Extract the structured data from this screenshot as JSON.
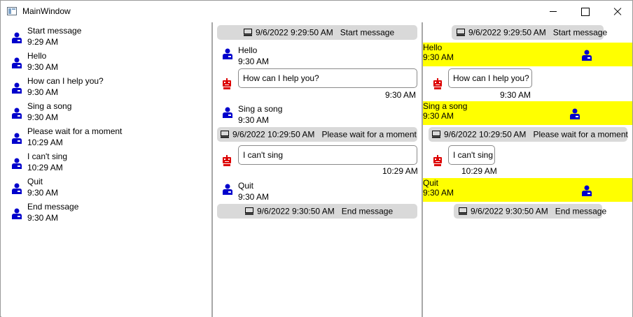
{
  "window": {
    "title": "MainWindow"
  },
  "list_view": [
    {
      "text": "Start message",
      "time": "9:29 AM"
    },
    {
      "text": "Hello",
      "time": "9:30 AM"
    },
    {
      "text": "How can I help you?",
      "time": "9:30 AM"
    },
    {
      "text": "Sing a song",
      "time": "9:30 AM"
    },
    {
      "text": "Please wait for a moment",
      "time": "10:29 AM"
    },
    {
      "text": "I can't sing",
      "time": "10:29 AM"
    },
    {
      "text": "Quit",
      "time": "9:30 AM"
    },
    {
      "text": "End message",
      "time": "9:30 AM"
    }
  ],
  "chat": {
    "sys_start": {
      "datetime": "9/6/2022 9:29:50 AM",
      "text": "Start message"
    },
    "user_hello": {
      "text": "Hello",
      "time": "9:30 AM"
    },
    "bot_help": {
      "text": "How can I help you?",
      "time": "9:30 AM"
    },
    "user_sing": {
      "text": "Sing a song",
      "time": "9:30 AM"
    },
    "sys_wait": {
      "datetime": "9/6/2022 10:29:50 AM",
      "text": "Please wait for a moment"
    },
    "bot_cant": {
      "text": "I can't sing",
      "time": "10:29 AM"
    },
    "user_quit": {
      "text": "Quit",
      "time": "9:30 AM"
    },
    "sys_end": {
      "datetime": "9/6/2022 9:30:50 AM",
      "text": "End message"
    }
  },
  "colors": {
    "user_icon": "#0000cc",
    "bot_icon": "#dd0000",
    "user_highlight": "#ffff00",
    "system_bubble": "#d9d9d9"
  },
  "icons": {
    "user": "person-icon",
    "bot": "robot-icon",
    "system": "monitor-icon",
    "app": "window-icon"
  }
}
